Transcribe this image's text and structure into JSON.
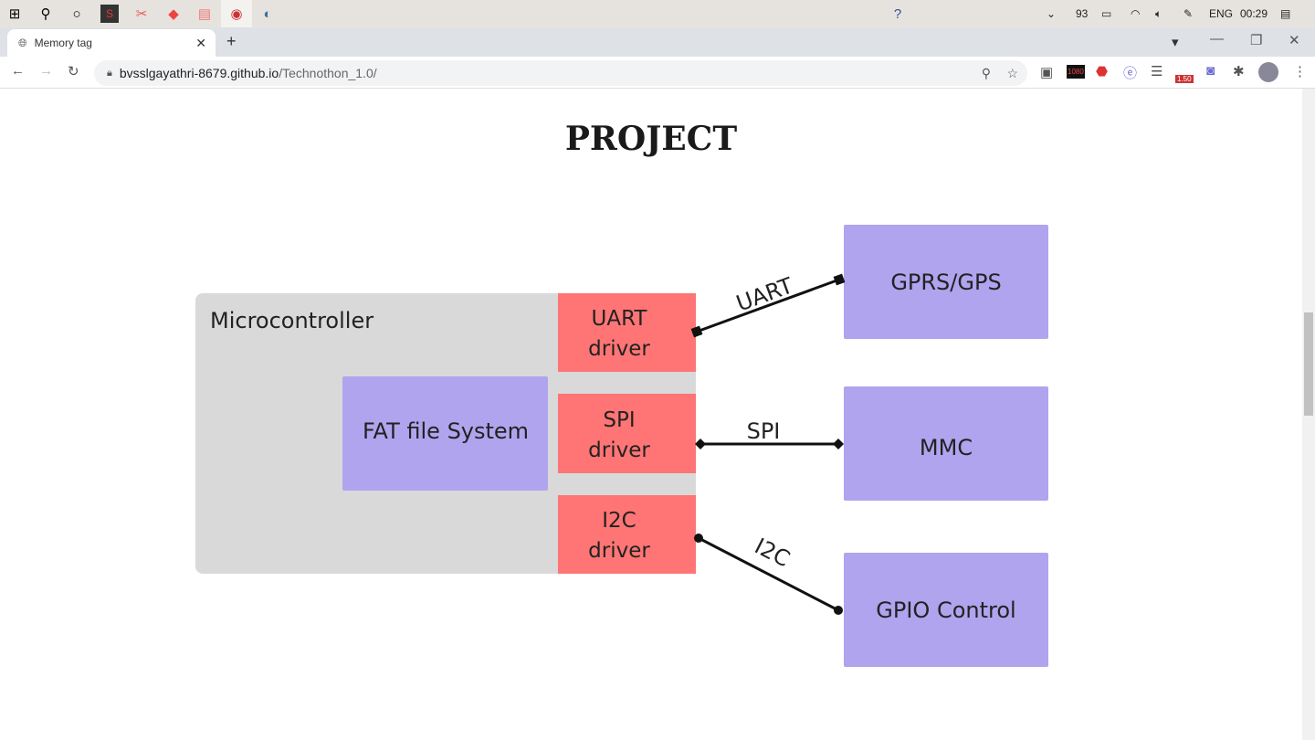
{
  "taskbar": {
    "tray": {
      "battery_percent": "93",
      "language": "ENG",
      "time": "00:29"
    },
    "icons": [
      "windows-start-icon",
      "search-icon",
      "cortana-icon",
      "app-icon",
      "paint-icon",
      "brave-icon",
      "files-icon",
      "chrome-icon",
      "edge-icon"
    ]
  },
  "browser": {
    "tab_title": "Memory tag",
    "url_host": "bvsslgayathri-8679.github.io",
    "url_path": "/Technothon_1.0/",
    "ext_badge": "1.50",
    "ext_1080": "1080"
  },
  "page": {
    "title": "PROJECT"
  },
  "diagram": {
    "microcontroller": "Microcontroller",
    "fat": "FAT file System",
    "drivers": [
      {
        "l1": "UART",
        "l2": "driver"
      },
      {
        "l1": "SPI",
        "l2": "driver"
      },
      {
        "l1": "I2C",
        "l2": "driver"
      }
    ],
    "links": [
      "UART",
      "SPI",
      "I2C"
    ],
    "devices": [
      "GPRS/GPS",
      "MMC",
      "GPIO Control"
    ],
    "colors": {
      "micro": "#d9d9d9",
      "driver": "#ff7575",
      "block": "#b0a4ef",
      "line": "#111111"
    }
  }
}
